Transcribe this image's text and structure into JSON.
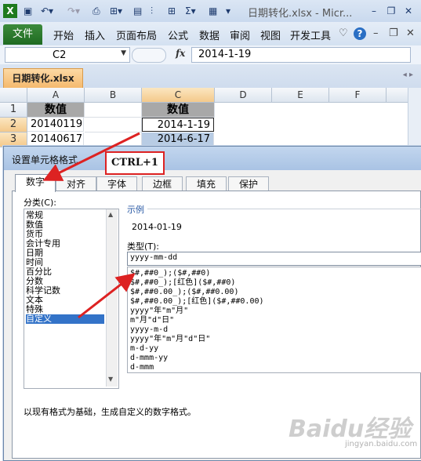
{
  "window": {
    "title": "日期转化.xlsx - Micr..."
  },
  "ribbon": {
    "file_tab": "文件",
    "tabs": [
      "开始",
      "插入",
      "页面布局",
      "公式",
      "数据",
      "审阅",
      "视图",
      "开发工具"
    ]
  },
  "formula_bar": {
    "name_box": "C2",
    "fx": "fx",
    "value": "2014-1-19"
  },
  "workbook_tab": "日期转化.xlsx",
  "grid": {
    "columns": [
      "A",
      "B",
      "C",
      "D",
      "E",
      "F"
    ],
    "rows": [
      "1",
      "2",
      "3"
    ],
    "cells": {
      "A1": "数值",
      "A2": "20140119",
      "A3": "20140617",
      "C1": "数值",
      "C2": "2014-1-19",
      "C3": "2014-6-17"
    }
  },
  "annotation": {
    "shortcut": "CTRL+1"
  },
  "dialog": {
    "title": "设置单元格格式",
    "tabs": [
      "数字",
      "对齐",
      "字体",
      "边框",
      "填充",
      "保护"
    ],
    "category_label": "分类(C):",
    "categories": [
      "常规",
      "数值",
      "货币",
      "会计专用",
      "日期",
      "时间",
      "百分比",
      "分数",
      "科学记数",
      "文本",
      "特殊",
      "自定义"
    ],
    "selected_category": "自定义",
    "sample_label": "示例",
    "sample_value": "2014-01-19",
    "type_label": "类型(T):",
    "type_value": "yyyy-mm-dd",
    "formats": [
      "$#,##0_);($#,##0)",
      "$#,##0_);[红色]($#,##0)",
      "$#,##0.00_);($#,##0.00)",
      "$#,##0.00_);[红色]($#,##0.00)",
      "yyyy\"年\"m\"月\"",
      "m\"月\"d\"日\"",
      "yyyy-m-d",
      "yyyy\"年\"m\"月\"d\"日\"",
      "m-d-yy",
      "d-mmm-yy",
      "d-mmm"
    ],
    "description": "以现有格式为基础，生成自定义的数字格式。"
  },
  "watermark": {
    "brand": "Baidu经验",
    "sub": "jingyan.baidu.com"
  },
  "colors": {
    "accent": "#3373c8",
    "file_tab": "#1f6b22",
    "highlight_border": "#dd2222"
  }
}
